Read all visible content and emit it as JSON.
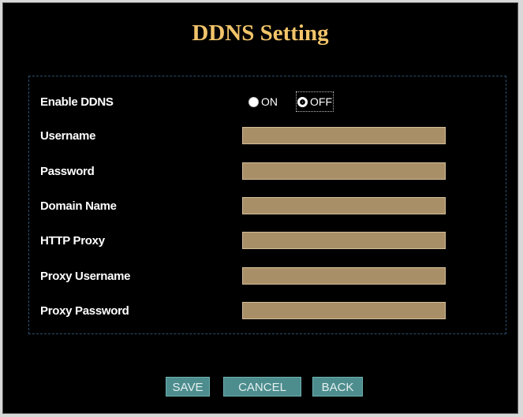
{
  "title": "DDNS Setting",
  "enable": {
    "label": "Enable DDNS",
    "options": [
      "ON",
      "OFF"
    ],
    "selected": "OFF"
  },
  "fields": [
    {
      "label": "Username",
      "value": ""
    },
    {
      "label": "Password",
      "value": ""
    },
    {
      "label": "Domain Name",
      "value": ""
    },
    {
      "label": "HTTP Proxy",
      "value": ""
    },
    {
      "label": "Proxy Username",
      "value": ""
    },
    {
      "label": "Proxy Password",
      "value": ""
    }
  ],
  "buttons": {
    "save": "SAVE",
    "cancel": "CANCEL",
    "back": "BACK"
  },
  "colors": {
    "background": "#000000",
    "title": "#f2c46a",
    "field": "#a98f68",
    "button": "#4d8d8e"
  }
}
